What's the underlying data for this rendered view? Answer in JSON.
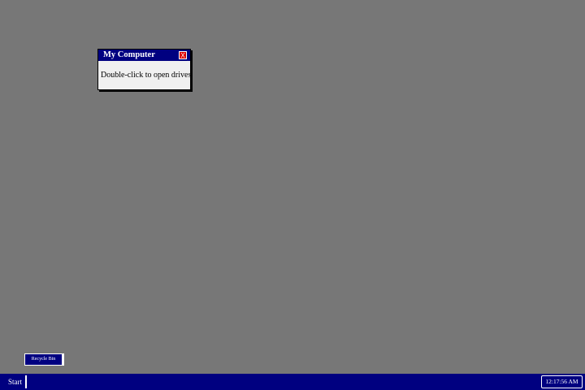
{
  "colors": {
    "desktop_background": "#777777",
    "titlebar": "#000080",
    "taskbar": "#000080",
    "close_button": "#e00000",
    "window_body": "#f0f0f0"
  },
  "window": {
    "title": "My Computer",
    "close_label": "X",
    "body_text": "Double-click to open drives"
  },
  "desktop_icons": [
    {
      "label": "Recycle Bin",
      "icon": "recycle-bin-icon"
    }
  ],
  "taskbar": {
    "start_label": "Start",
    "clock": "12:17:56 AM"
  }
}
